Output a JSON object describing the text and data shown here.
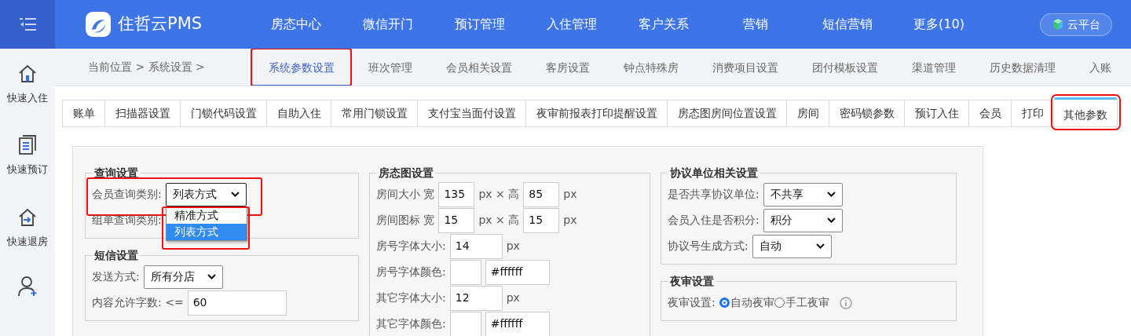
{
  "topbar": {
    "logo_text": "住哲云PMS",
    "menu": [
      "房态中心",
      "微信开门",
      "预订管理",
      "入住管理",
      "客户关系",
      "营销",
      "短信营销",
      "更多(10)"
    ],
    "cloud_button": "云平台"
  },
  "sidebar": {
    "items": [
      {
        "label": "快速入住"
      },
      {
        "label": "快速预订"
      },
      {
        "label": "快速退房"
      }
    ]
  },
  "breadcrumb": "当前位置 > 系统设置 >",
  "section_tabs": [
    {
      "label": "系统参数设置",
      "selected": true,
      "highlighted": true
    },
    {
      "label": "班次管理",
      "selected": false,
      "highlighted": false
    },
    {
      "label": "会员相关设置",
      "selected": false,
      "highlighted": false
    },
    {
      "label": "客房设置",
      "selected": false,
      "highlighted": false
    },
    {
      "label": "钟点特殊房",
      "selected": false,
      "highlighted": false
    },
    {
      "label": "消费项目设置",
      "selected": false,
      "highlighted": false
    },
    {
      "label": "团付模板设置",
      "selected": false,
      "highlighted": false
    },
    {
      "label": "渠道管理",
      "selected": false,
      "highlighted": false
    },
    {
      "label": "历史数据清理",
      "selected": false,
      "highlighted": false
    },
    {
      "label": "入账",
      "selected": false,
      "highlighted": false
    }
  ],
  "sub_tabs": [
    {
      "label": "账单",
      "selected": false,
      "highlighted": false
    },
    {
      "label": "扫描器设置",
      "selected": false,
      "highlighted": false
    },
    {
      "label": "门锁代码设置",
      "selected": false,
      "highlighted": false
    },
    {
      "label": "自助入住",
      "selected": false,
      "highlighted": false
    },
    {
      "label": "常用门锁设置",
      "selected": false,
      "highlighted": false
    },
    {
      "label": "支付宝当面付设置",
      "selected": false,
      "highlighted": false
    },
    {
      "label": "夜审前报表打印提醒设置",
      "selected": false,
      "highlighted": false
    },
    {
      "label": "房态图房间位置设置",
      "selected": false,
      "highlighted": false
    },
    {
      "label": "房间",
      "selected": false,
      "highlighted": false
    },
    {
      "label": "密码锁参数",
      "selected": false,
      "highlighted": false
    },
    {
      "label": "预订入住",
      "selected": false,
      "highlighted": false
    },
    {
      "label": "会员",
      "selected": false,
      "highlighted": false
    },
    {
      "label": "打印",
      "selected": false,
      "highlighted": false
    },
    {
      "label": "其他参数",
      "selected": true,
      "highlighted": true
    }
  ],
  "columns": [
    [
      {
        "title": "查询设置",
        "rows": [
          {
            "kind": "select",
            "label": "会员查询类别:",
            "value": "列表方式",
            "highlighted": true,
            "expanded": true,
            "options": [
              {
                "label": "精准方式",
                "selected": false
              },
              {
                "label": "列表方式",
                "selected": true
              }
            ]
          },
          {
            "kind": "label",
            "label": "组单查询类别:"
          }
        ]
      },
      {
        "title": "短信设置",
        "rows": [
          {
            "kind": "select",
            "label": "发送方式:",
            "value": "所有分店",
            "highlighted": false,
            "expanded": false
          },
          {
            "kind": "input",
            "label": "内容允许字数: <=",
            "value": "60"
          }
        ]
      }
    ],
    [
      {
        "title": "房态图设置",
        "rows": [
          {
            "kind": "pair",
            "label": "房间大小 宽",
            "value": "135",
            "mid": "px × 高",
            "value2": "85",
            "unit": "px"
          },
          {
            "kind": "pair",
            "label": "房间图标 宽",
            "value": "15",
            "mid": "px × 高",
            "value2": "15",
            "unit": "px"
          },
          {
            "kind": "input",
            "label": "房号字体大小:",
            "value": "14",
            "unit": "px"
          },
          {
            "kind": "color",
            "label": "房号字体颜色:",
            "value": "#ffffff"
          },
          {
            "kind": "input",
            "label": "其它字体大小:",
            "value": "12",
            "unit": "px"
          },
          {
            "kind": "color",
            "label": "其它字体颜色:",
            "value": "#ffffff"
          }
        ]
      }
    ],
    [
      {
        "title": "协议单位相关设置",
        "rows": [
          {
            "kind": "select",
            "label": "是否共享协议单位:",
            "value": "不共享",
            "highlighted": false,
            "expanded": false
          },
          {
            "kind": "select",
            "label": "会员入住是否积分:",
            "value": "积分",
            "highlighted": false,
            "expanded": false
          },
          {
            "kind": "select",
            "label": "协议号生成方式:",
            "value": "自动",
            "highlighted": false,
            "expanded": false
          }
        ]
      },
      {
        "title": "夜审设置",
        "rows": [
          {
            "kind": "radio",
            "label": "夜审设置:",
            "options": [
              {
                "label": "自动夜审",
                "selected": true
              },
              {
                "label": "手工夜审",
                "selected": false
              }
            ]
          }
        ]
      }
    ]
  ]
}
